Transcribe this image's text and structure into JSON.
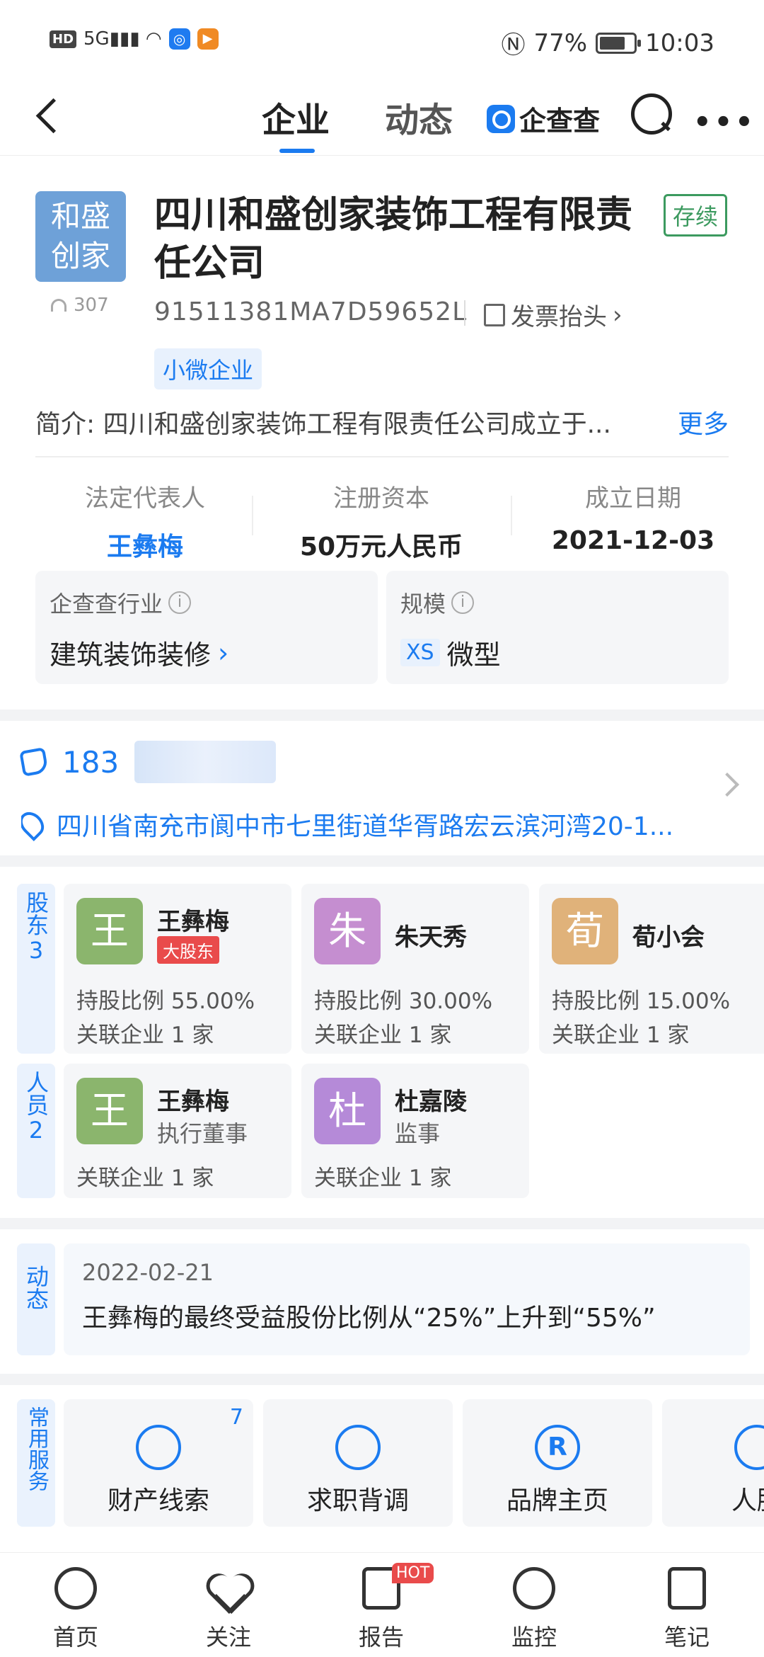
{
  "status_bar": {
    "left_badge": "HD",
    "signal": "5G",
    "battery_percent_text": "77%",
    "battery_level": 0.77,
    "time": "10:03"
  },
  "nav": {
    "tabs": [
      {
        "label": "企业",
        "active": true
      },
      {
        "label": "动态",
        "active": false
      }
    ],
    "brand": "企查查"
  },
  "company": {
    "logo_text_line1": "和盛",
    "logo_text_line2": "创家",
    "views": "307",
    "name": "四川和盛创家装饰工程有限责任公司",
    "status": "存续",
    "credit_code": "91511381MA7D59652L",
    "invoice_label": "发票抬头",
    "tag": "小微企业",
    "intro_label": "简介:",
    "intro_text": "四川和盛创家装饰工程有限责任公司成立于...",
    "intro_more": "更多"
  },
  "key_info": [
    {
      "label": "法定代表人",
      "value": "王彝梅",
      "link": true
    },
    {
      "label": "注册资本",
      "value": "50万元人民币",
      "link": false
    },
    {
      "label": "成立日期",
      "value": "2021-12-03",
      "link": false
    }
  ],
  "industry": {
    "label": "企查查行业",
    "value": "建筑装饰装修"
  },
  "scale": {
    "label": "规模",
    "badge": "XS",
    "value": "微型"
  },
  "contact": {
    "phone_prefix": "183",
    "address": "四川省南充市阆中市七里街道华胥路宏云滨河湾20-1..."
  },
  "shareholders": {
    "label": "股东",
    "count": "3",
    "items": [
      {
        "avatar": "王",
        "name": "王彝梅",
        "tag": "大股东",
        "ratio_label": "持股比例",
        "ratio": "55.00%",
        "related_label": "关联企业",
        "related": "1 家",
        "color": "#8bb56d"
      },
      {
        "avatar": "朱",
        "name": "朱天秀",
        "tag": "",
        "ratio_label": "持股比例",
        "ratio": "30.00%",
        "related_label": "关联企业",
        "related": "1 家",
        "color": "#c58ed0"
      },
      {
        "avatar": "荀",
        "name": "荀小会",
        "tag": "",
        "ratio_label": "持股比例",
        "ratio": "15.00%",
        "related_label": "关联企业",
        "related": "1 家",
        "color": "#e0b27a"
      }
    ]
  },
  "personnel": {
    "label": "人员",
    "count": "2",
    "items": [
      {
        "avatar": "王",
        "name": "王彝梅",
        "role": "执行董事",
        "related_label": "关联企业",
        "related": "1 家",
        "color": "#8bb56d"
      },
      {
        "avatar": "杜",
        "name": "杜嘉陵",
        "role": "监事",
        "related_label": "关联企业",
        "related": "1 家",
        "color": "#b58ad8"
      }
    ]
  },
  "dynamic": {
    "label": "动态",
    "date": "2022-02-21",
    "text": "王彝梅的最终受益股份比例从“25%”上升到“55%”"
  },
  "services": {
    "label": "常用服务",
    "items": [
      {
        "label": "财产线索",
        "badge": "7",
        "icon": "property-clue-icon"
      },
      {
        "label": "求职背调",
        "badge": "",
        "icon": "job-check-icon"
      },
      {
        "label": "品牌主页",
        "badge": "",
        "icon": "brand-r-icon"
      },
      {
        "label": "人脉",
        "badge": "",
        "icon": "network-icon"
      }
    ]
  },
  "tabbar": {
    "items": [
      {
        "label": "首页",
        "icon": "home-icon"
      },
      {
        "label": "关注",
        "icon": "heart-icon"
      },
      {
        "label": "报告",
        "icon": "report-icon",
        "badge": "HOT"
      },
      {
        "label": "监控",
        "icon": "monitor-icon"
      },
      {
        "label": "笔记",
        "icon": "note-icon"
      }
    ]
  }
}
